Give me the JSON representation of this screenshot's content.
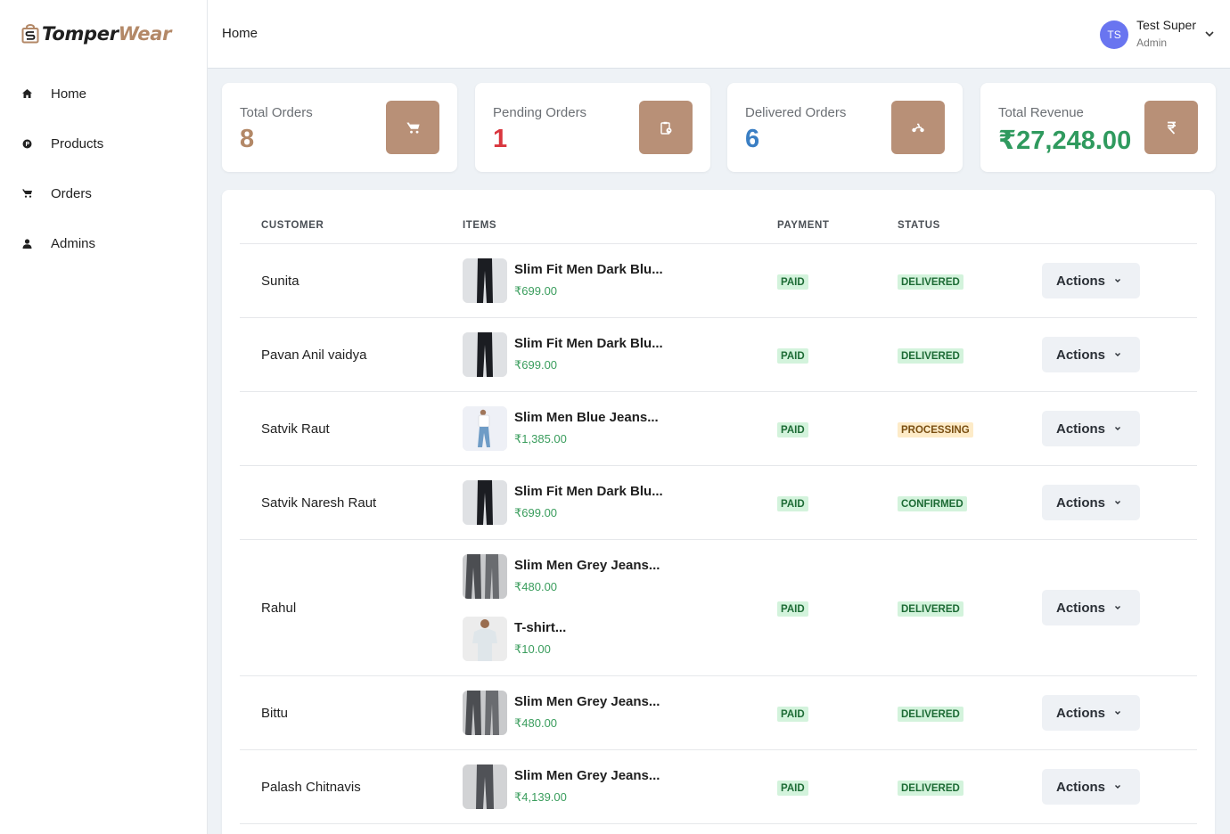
{
  "brand": {
    "part1": "Tomper",
    "part2": "Wear",
    "icon": "shopping-bag-logo-icon"
  },
  "sidebar": {
    "items": [
      {
        "label": "Home",
        "icon": "home-icon"
      },
      {
        "label": "Products",
        "icon": "product-icon"
      },
      {
        "label": "Orders",
        "icon": "cart-icon"
      },
      {
        "label": "Admins",
        "icon": "user-icon"
      }
    ]
  },
  "header": {
    "breadcrumb": "Home",
    "user": {
      "initials": "TS",
      "name": "Test Super",
      "role": "Admin"
    }
  },
  "stats": [
    {
      "label": "Total Orders",
      "value": "8",
      "color": "#b38867",
      "icon": "cart-icon"
    },
    {
      "label": "Pending Orders",
      "value": "1",
      "color": "#d9363e",
      "icon": "clipboard-clock-icon"
    },
    {
      "label": "Delivered Orders",
      "value": "6",
      "color": "#3b7fc4",
      "icon": "scooter-icon"
    },
    {
      "label": "Total Revenue",
      "value": "₹27,248.00",
      "color": "#2f9a5e",
      "icon": "rupee-icon"
    }
  ],
  "table": {
    "headers": {
      "customer": "CUSTOMER",
      "items": "ITEMS",
      "payment": "PAYMENT",
      "status": "STATUS"
    },
    "actions_label": "Actions",
    "rows": [
      {
        "customer": "Sunita",
        "payment": "PAID",
        "status": "DELIVERED",
        "items": [
          {
            "name": "Slim Fit Men Dark Blu...",
            "price": "₹699.00"
          }
        ]
      },
      {
        "customer": "Pavan Anil vaidya",
        "payment": "PAID",
        "status": "DELIVERED",
        "items": [
          {
            "name": "Slim Fit Men Dark Blu...",
            "price": "₹699.00"
          }
        ]
      },
      {
        "customer": "Satvik Raut",
        "payment": "PAID",
        "status": "PROCESSING",
        "items": [
          {
            "name": "Slim Men Blue Jeans...",
            "price": "₹1,385.00"
          }
        ]
      },
      {
        "customer": "Satvik Naresh Raut",
        "payment": "PAID",
        "status": "CONFIRMED",
        "items": [
          {
            "name": "Slim Fit Men Dark Blu...",
            "price": "₹699.00"
          }
        ]
      },
      {
        "customer": "Rahul",
        "payment": "PAID",
        "status": "DELIVERED",
        "items": [
          {
            "name": "Slim Men Grey Jeans...",
            "price": "₹480.00"
          },
          {
            "name": "T-shirt...",
            "price": "₹10.00"
          }
        ]
      },
      {
        "customer": "Bittu",
        "payment": "PAID",
        "status": "DELIVERED",
        "items": [
          {
            "name": "Slim Men Grey Jeans...",
            "price": "₹480.00"
          }
        ]
      },
      {
        "customer": "Palash Chitnavis",
        "payment": "PAID",
        "status": "DELIVERED",
        "items": [
          {
            "name": "Slim Men Grey Jeans...",
            "price": "₹4,139.00"
          }
        ]
      }
    ]
  }
}
